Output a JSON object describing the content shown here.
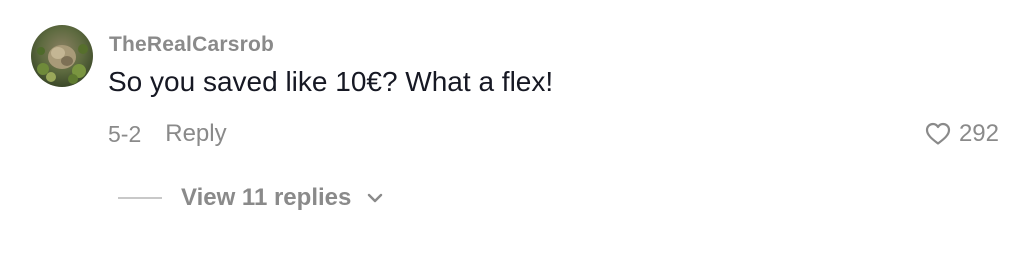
{
  "comment": {
    "username": "TheRealCarsrob",
    "text": "So you saved like 10€? What a flex!",
    "date": "5-2",
    "reply_label": "Reply",
    "like_count": "292",
    "view_replies_label": "View 11 replies"
  },
  "icons": {
    "like": "heart-outline-icon",
    "expand": "chevron-down-icon"
  },
  "colors": {
    "primary_text": "#161823",
    "secondary_text": "#8a8a8a",
    "divider": "#c8c8c8",
    "background": "#ffffff"
  }
}
